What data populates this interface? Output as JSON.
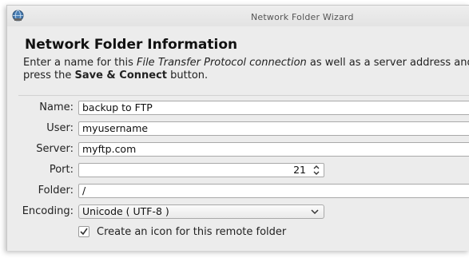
{
  "window": {
    "title": "Network Folder Wizard"
  },
  "page": {
    "heading": "Network Folder Information",
    "description": {
      "part1": "Enter a name for this ",
      "protocol": "File Transfer Protocol connection",
      "part2": " as well as a server address and",
      "line2_prefix": "press the ",
      "button_ref": "Save & Connect",
      "line2_suffix": " button."
    }
  },
  "form": {
    "name_label": "Name:",
    "name_value": "backup to FTP",
    "user_label": "User:",
    "user_value": "myusername",
    "server_label": "Server:",
    "server_value": "myftp.com",
    "port_label": "Port:",
    "port_value": "21",
    "folder_label": "Folder:",
    "folder_value": "/",
    "encoding_label": "Encoding:",
    "encoding_value": "Unicode ( UTF-8 )",
    "create_icon_label": "Create an icon for this remote folder",
    "create_icon_checked": true
  },
  "icons": {
    "app": "network-globe-icon",
    "spin": "spin-updown-icon",
    "combo": "chevron-down-icon",
    "check": "checkmark-icon"
  }
}
